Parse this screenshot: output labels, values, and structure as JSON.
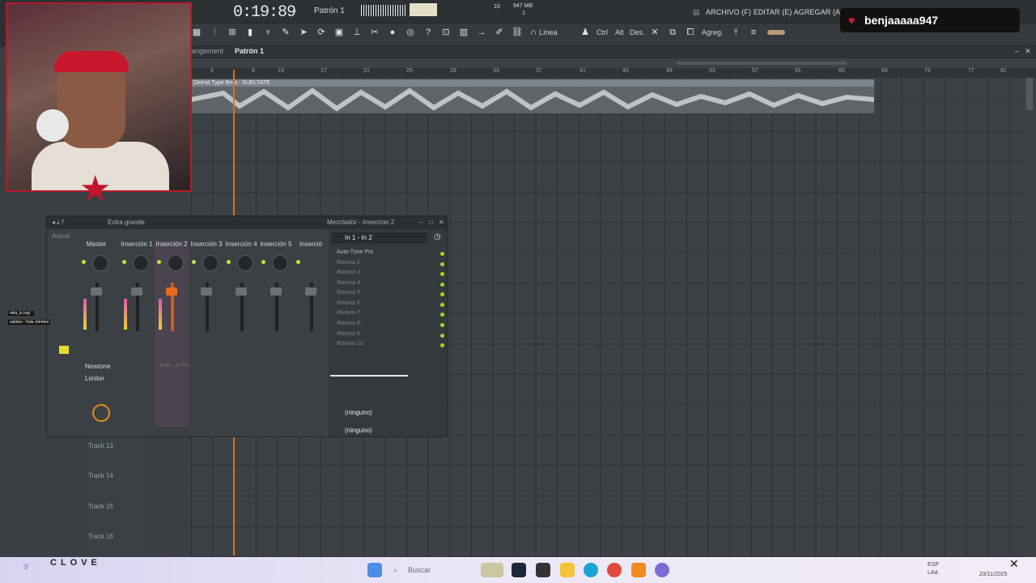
{
  "topbar": {
    "time": "0:19:89",
    "pattern": "Patrón 1",
    "cpu": "947 MB",
    "cpu_sub": "1",
    "voices": "10",
    "menu": "ARCHIVO (F) EDITAR (E) AGREGAR (A) PATRONES",
    "snap": "Línea",
    "mode_ctrl": "Ctrl",
    "mode_alt": "Alt",
    "mode_des": "Des.",
    "mode_agreg": "Agreg."
  },
  "stream": {
    "username": "benjaaaaa947",
    "chat": [
      "mila_lo.logi :",
      "zalotes : hola chimtoo"
    ]
  },
  "playlist": {
    "tab_left": "angement",
    "tab_pattern": "Patrón 1",
    "clip_title": "Detroit Type Beat - SUELTATE",
    "ruler": [
      "5",
      "9",
      "13",
      "17",
      "21",
      "25",
      "29",
      "33",
      "37",
      "41",
      "45",
      "49",
      "53",
      "57",
      "61",
      "65",
      "69",
      "73",
      "77",
      "81"
    ],
    "tracks": [
      "Track 13",
      "Track 14",
      "Track 15",
      "Track 16"
    ]
  },
  "mixer": {
    "size": "Extra grande",
    "window_title": "Mezclador - Insercion 2",
    "actual_label": "Actual",
    "route": "In 1 - In 2",
    "channels": [
      "Master",
      "Inserción 1",
      "Inserción 2",
      "Inserción 3",
      "Inserción 4",
      "Inserción 5",
      "Inserció"
    ],
    "plugin1": "Newtone",
    "plugin2": "Limiter",
    "plugin_faded": "Auto...e Pro",
    "slots": [
      "Auto-Tune Pro",
      "Ranura 2",
      "Ranura 3",
      "Ranura 4",
      "Ranura 5",
      "Ranura 6",
      "Ranura 7",
      "Ranura 8",
      "Ranura 9",
      "Ranura 10"
    ],
    "send1": "(ninguno)",
    "send2": "(ninguno)"
  },
  "taskbar": {
    "brand": "CLOVE",
    "search": "Buscar",
    "lang": "ESP",
    "lang2": "LAA",
    "date": "23/11/2025"
  },
  "colors": {
    "accent": "#e56d1c",
    "led": "#c9e33a",
    "heart": "#e01d34"
  }
}
